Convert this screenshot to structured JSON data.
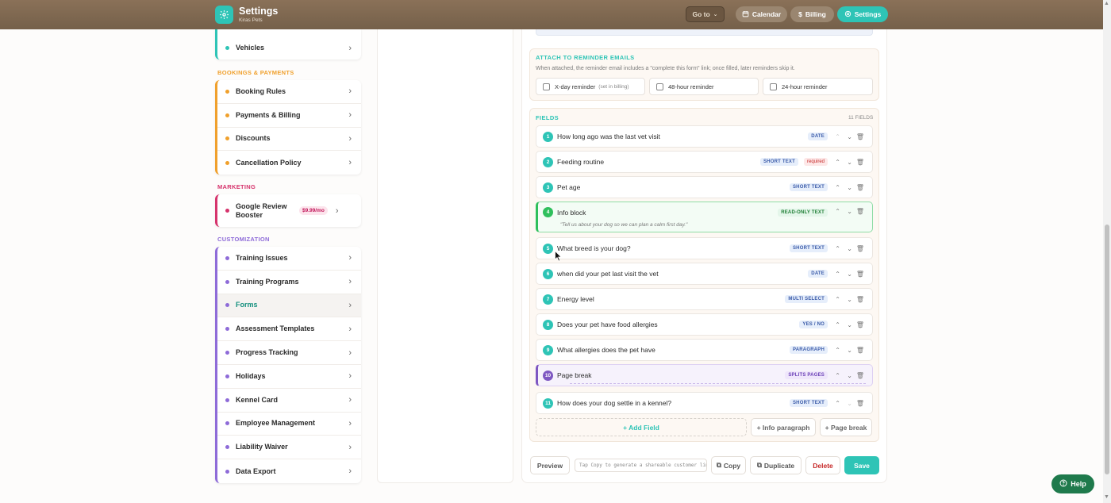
{
  "header": {
    "title": "Settings",
    "subtitle": "Kiras Pets",
    "goto_label": "Go to",
    "calendar_label": "Calendar",
    "billing_label": "Billing",
    "settings_label": "Settings"
  },
  "sidebar": {
    "vehicles": "Vehicles",
    "bookings_section": "BOOKINGS & PAYMENTS",
    "bookings": [
      "Booking Rules",
      "Payments & Billing",
      "Discounts",
      "Cancellation Policy"
    ],
    "marketing_section": "MARKETING",
    "marketing_item": "Google Review Booster",
    "marketing_price": "$9.99/mo",
    "customization_section": "CUSTOMIZATION",
    "customization": [
      "Training Issues",
      "Training Programs",
      "Forms",
      "Assessment Templates",
      "Progress Tracking",
      "Holidays",
      "Kennel Card",
      "Employee Management",
      "Liability Waiver",
      "Data Export"
    ]
  },
  "attach": {
    "title": "ATTACH TO REMINDER EMAILS",
    "description": "When attached, the reminder email includes a \"complete this form\" link; once filled, later reminders skip it.",
    "options": [
      "X-day reminder",
      "48-hour reminder",
      "24-hour reminder"
    ],
    "x_day_note": "(set in billing)"
  },
  "fields": {
    "title": "FIELDS",
    "count": "11 FIELDS",
    "items": [
      {
        "num": "1",
        "label": "How long ago was the last vet visit",
        "type": "DATE"
      },
      {
        "num": "2",
        "label": "Feeding routine",
        "type": "SHORT TEXT",
        "required": "required"
      },
      {
        "num": "3",
        "label": "Pet age",
        "type": "SHORT TEXT"
      },
      {
        "num": "4",
        "label": "Info block",
        "type": "READ-ONLY TEXT",
        "sub": "\"Tell us about your dog so we can plan a calm first day.\""
      },
      {
        "num": "5",
        "label": "What breed is your dog?",
        "type": "SHORT TEXT"
      },
      {
        "num": "6",
        "label": "when did your pet last visit the vet",
        "type": "DATE"
      },
      {
        "num": "7",
        "label": "Energy level",
        "type": "MULTI SELECT"
      },
      {
        "num": "8",
        "label": "Does your pet have food allergies",
        "type": "YES / NO"
      },
      {
        "num": "9",
        "label": "What allergies does the pet have",
        "type": "PARAGRAPH"
      },
      {
        "num": "10",
        "label": "Page break",
        "type": "SPLITS PAGES"
      },
      {
        "num": "11",
        "label": "How does your dog settle in a kennel?",
        "type": "SHORT TEXT"
      }
    ],
    "add_field": "+ Add Field",
    "add_info": "+ Info paragraph",
    "add_page_break": "+ Page break"
  },
  "footer": {
    "preview": "Preview",
    "share_placeholder": "Tap Copy to generate a shareable customer link",
    "copy": "Copy",
    "duplicate": "Duplicate",
    "delete": "Delete",
    "save": "Save"
  },
  "help_label": "Help",
  "colors": {
    "accent": "#2ec4b6",
    "header_bg": "#7d6650",
    "bookings": "#f0a02c",
    "marketing": "#d6336c",
    "customization": "#8e6bd8",
    "vehicles": "#2ec4b6"
  }
}
